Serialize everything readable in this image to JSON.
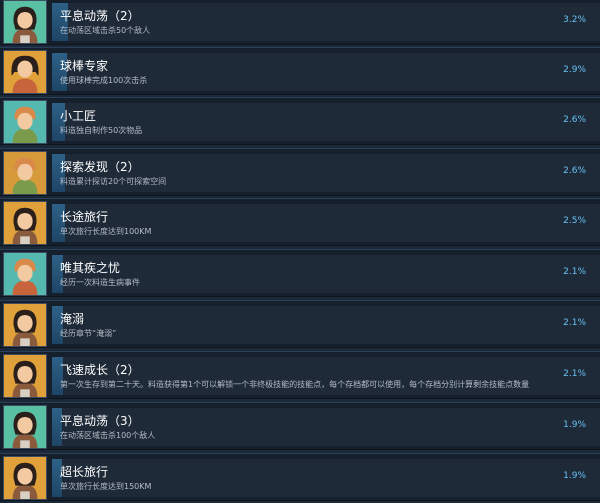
{
  "achievements": [
    {
      "title": "平息动荡（2）",
      "desc": "在动荡区域击杀50个敌人",
      "percent_label": "3.2%",
      "percent": 3.2,
      "avatar": "dark-hair-girl-icon",
      "bg": "#5ac0a4"
    },
    {
      "title": "球棒专家",
      "desc": "使用球棒完成100次击杀",
      "percent_label": "2.9%",
      "percent": 2.9,
      "avatar": "dark-hair-woman-icon",
      "bg": "#e0a13a"
    },
    {
      "title": "小工匠",
      "desc": "料造独自制作50次物品",
      "percent_label": "2.6%",
      "percent": 2.6,
      "avatar": "ginger-boy-icon",
      "bg": "#55b9b0"
    },
    {
      "title": "探索发现（2）",
      "desc": "料造累计探访20个可探索空间",
      "percent_label": "2.6%",
      "percent": 2.6,
      "avatar": "ginger-boy-icon",
      "bg": "#d79a3a"
    },
    {
      "title": "长途旅行",
      "desc": "单次旅行长度达到100KM",
      "percent_label": "2.5%",
      "percent": 2.5,
      "avatar": "dark-hair-girl-icon",
      "bg": "#e0a13a"
    },
    {
      "title": "唯其疾之忧",
      "desc": "经历一次料造生病事件",
      "percent_label": "2.1%",
      "percent": 2.1,
      "avatar": "ginger-boy-icon",
      "bg": "#55b9b0"
    },
    {
      "title": "淹溺",
      "desc": "经历章节“淹溺”",
      "percent_label": "2.1%",
      "percent": 2.1,
      "avatar": "dark-hair-girl-icon",
      "bg": "#e0a13a"
    },
    {
      "title": "飞速成长（2）",
      "desc": "第一次生存到第二十天。料造获得第1个可以解锁一个非终极技能的技能点，每个存档都可以使用，每个存档分别计算剩余技能点数量",
      "percent_label": "2.1%",
      "percent": 2.1,
      "avatar": "dark-hair-girl-icon",
      "bg": "#e0a13a"
    },
    {
      "title": "平息动荡（3）",
      "desc": "在动荡区域击杀100个敌人",
      "percent_label": "1.9%",
      "percent": 1.9,
      "avatar": "dark-hair-girl-icon",
      "bg": "#5ac0a4"
    },
    {
      "title": "超长旅行",
      "desc": "单次旅行长度达到150KM",
      "percent_label": "1.9%",
      "percent": 1.9,
      "avatar": "dark-hair-girl-icon",
      "bg": "#e0a13a"
    }
  ]
}
